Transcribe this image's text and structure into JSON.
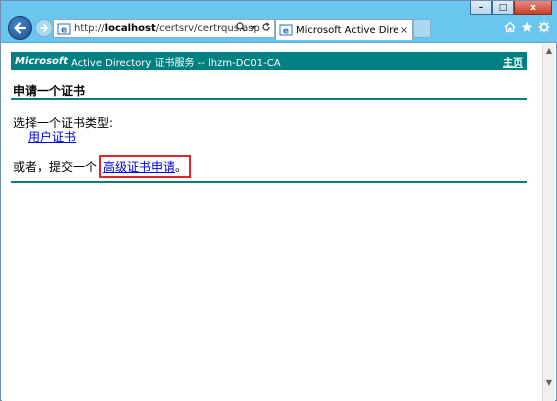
{
  "browser": {
    "window_buttons": {
      "minimize": "–",
      "maximize": "□",
      "close": "x"
    },
    "address_bar": {
      "url_prefix": "http://",
      "url_host": "localhost",
      "url_path": "/certsrv/certrqus.asp"
    },
    "tab": {
      "label": "Microsoft Active Director...",
      "close": "×"
    },
    "icons": [
      "back-icon",
      "forward-icon",
      "ie-site-icon",
      "search-icon",
      "dropdown-icon",
      "refresh-icon",
      "home-icon",
      "favorites-star-icon",
      "gear-icon"
    ],
    "accent_color": "#6ac6ee"
  },
  "page": {
    "banner": {
      "brand": "Microsoft",
      "service_text": "Active Directory 证书服务  --  lhzm-DC01-CA",
      "home_link": "主页",
      "color": "#008080"
    },
    "heading": "申请一个证书",
    "select_label": "选择一个证书类型:",
    "user_cert_link": "用户证书",
    "or_text": "或者，提交一个",
    "advanced_link": "高级证书申请",
    "advanced_suffix": "。",
    "highlight_color": "#e0262c"
  }
}
